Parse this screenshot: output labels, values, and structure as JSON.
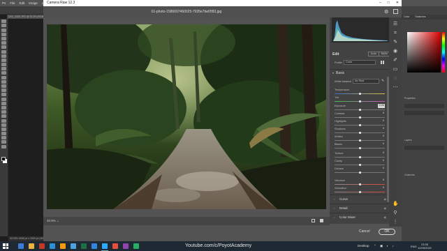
{
  "photoshop": {
    "menu": [
      "Ps",
      "File",
      "Edit",
      "Image",
      "Layer",
      "Type",
      "Select",
      "Filter"
    ],
    "doc_tab": "DSC_6100.JPG @ 33.3% (RGB/8)",
    "status": "33.33%   3008 px x 2000 px (300 ppi)",
    "right_tabs": [
      "Color",
      "Swatches"
    ],
    "right_labels": [
      "Properties",
      "Layers",
      "Channels"
    ]
  },
  "dialog": {
    "title": "Camera Raw 12.3",
    "window_buttons": [
      "–",
      "□",
      "✕"
    ],
    "filename": "01-photo-1586697460025-7935e7bef2f83.jpg",
    "zoom": "40.9% ⌄",
    "cancel_label": "Cancel",
    "ok_label": "OK"
  },
  "panel": {
    "edit_label": "Edit",
    "auto_label": "Auto",
    "bw_label": "B&W",
    "profile_label": "Profile",
    "profile_value": "Color",
    "basic_label": "Basic",
    "white_balance_label": "White balance",
    "white_balance_value": "As Shot",
    "sliders": [
      {
        "label": "Temperature",
        "value": "",
        "pos": 0.5,
        "group": 0,
        "highlight": false
      },
      {
        "label": "Tint",
        "value": "",
        "pos": 0.5,
        "group": 0,
        "highlight": false
      },
      {
        "label": "Exposure",
        "value": "0.00",
        "pos": 0.5,
        "group": 1,
        "highlight": true
      },
      {
        "label": "Contrast",
        "value": "0",
        "pos": 0.5,
        "group": 1,
        "highlight": false
      },
      {
        "label": "Highlights",
        "value": "0",
        "pos": 0.5,
        "group": 1,
        "highlight": false
      },
      {
        "label": "Shadows",
        "value": "0",
        "pos": 0.5,
        "group": 1,
        "highlight": false
      },
      {
        "label": "Whites",
        "value": "0",
        "pos": 0.5,
        "group": 1,
        "highlight": false
      },
      {
        "label": "Blacks",
        "value": "0",
        "pos": 0.5,
        "group": 1,
        "highlight": false
      },
      {
        "label": "Texture",
        "value": "0",
        "pos": 0.5,
        "group": 2,
        "highlight": false
      },
      {
        "label": "Clarity",
        "value": "0",
        "pos": 0.5,
        "group": 2,
        "highlight": false
      },
      {
        "label": "Dehaze",
        "value": "0",
        "pos": 0.5,
        "group": 2,
        "highlight": false
      },
      {
        "label": "Vibrance",
        "value": "0",
        "pos": 0.5,
        "group": 3,
        "highlight": false
      },
      {
        "label": "Saturation",
        "value": "0",
        "pos": 0.5,
        "group": 3,
        "highlight": false
      }
    ],
    "sections": [
      "Curve",
      "Detail",
      "Color Mixer"
    ]
  },
  "taskbar": {
    "overlay_text": "Youtube.com/c/PoyotAcademy",
    "desktop_label": "Desktop",
    "lang": "ENG",
    "time": "23:35",
    "date": "12/05/2021",
    "apps": [
      "#3b7bd4",
      "#e8b341",
      "#c0392b",
      "#2b8fd6",
      "#f39c12",
      "#4aa3df",
      "#1d6f42",
      "#2e86de",
      "#31a8ff",
      "#e74c3c",
      "#8e44ad",
      "#27ae60"
    ]
  },
  "icons": {
    "gear": "gear-icon",
    "eye": "eye-icon",
    "dropper": "eyedropper-icon"
  }
}
